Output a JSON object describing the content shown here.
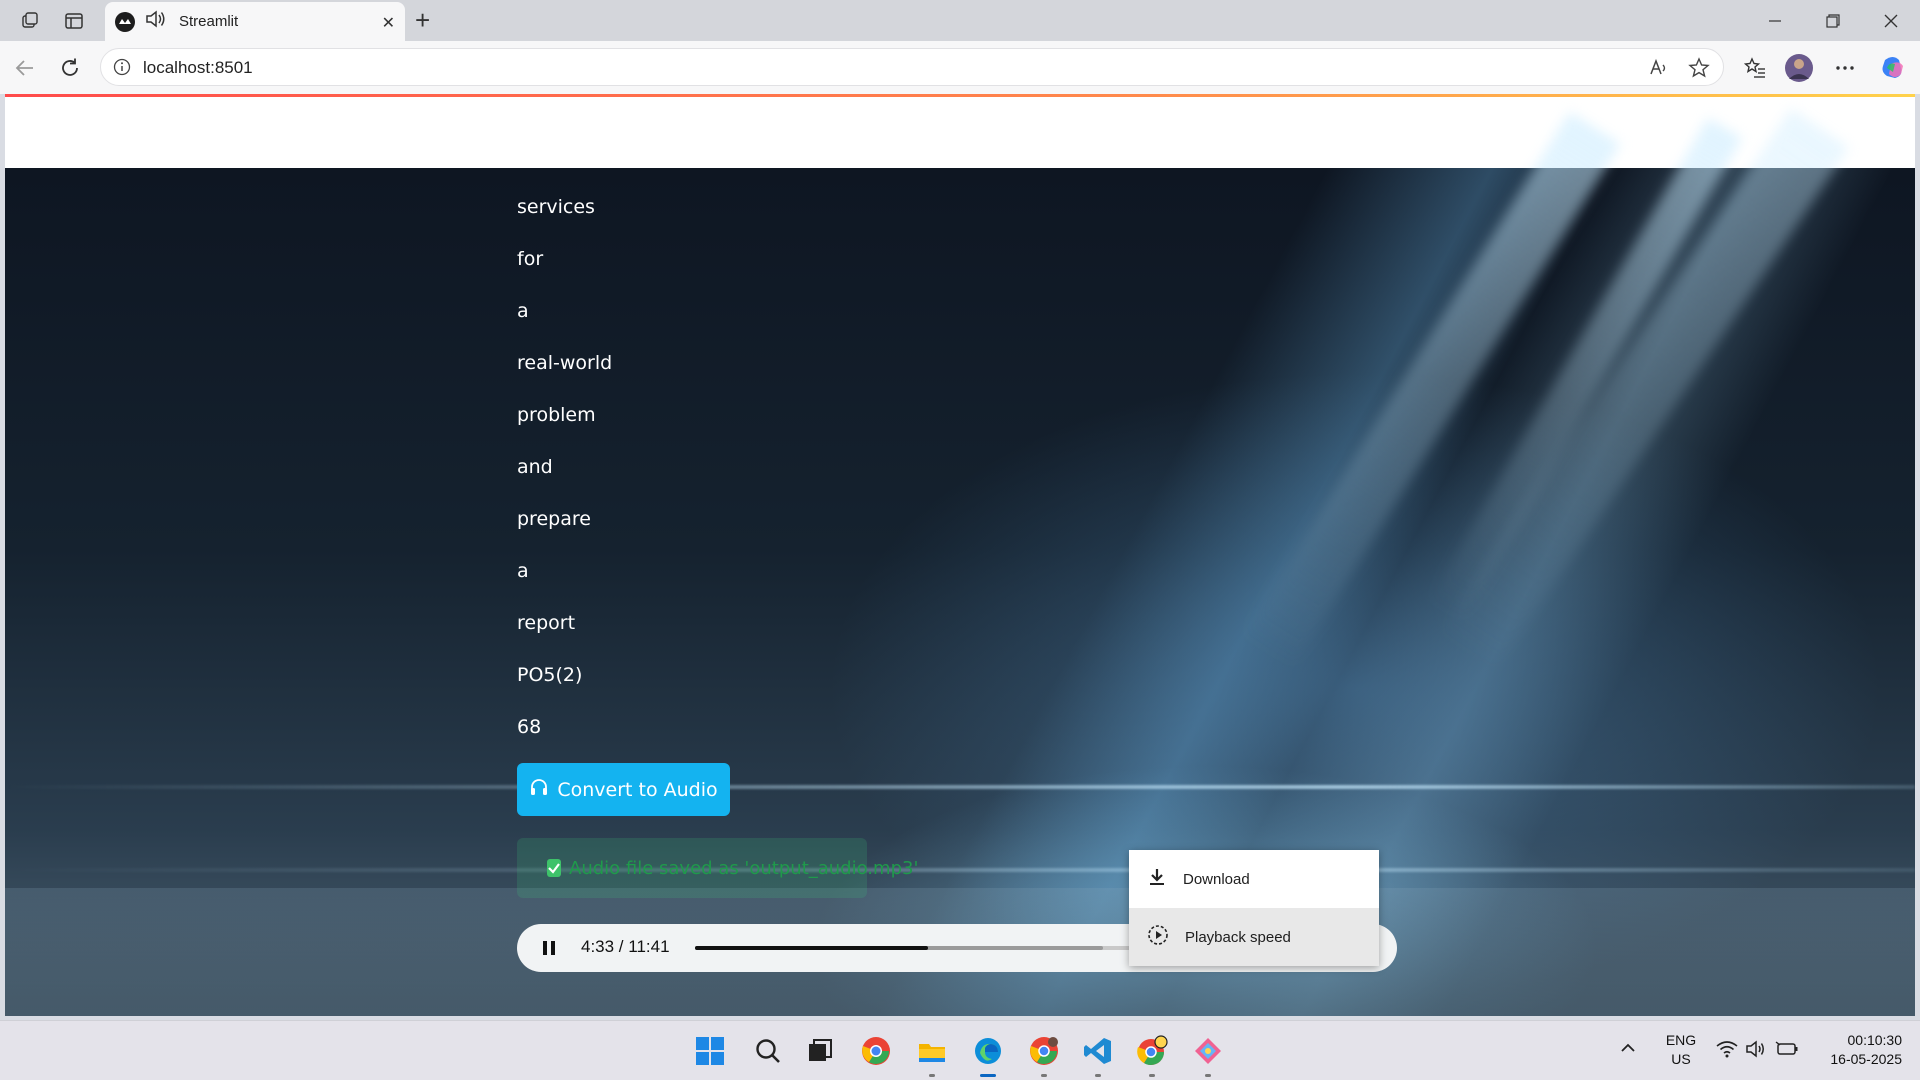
{
  "browser": {
    "tab_title": "Streamlit",
    "tab_close": "✕",
    "new_tab": "+",
    "url": "localhost:8501"
  },
  "content": {
    "words": [
      "services",
      "for",
      "a",
      "real-world",
      "problem",
      "and",
      "prepare",
      "a",
      "report",
      "PO5(2)",
      "68"
    ],
    "convert_button": "Convert to Audio",
    "success_message": "Audio file saved as 'output_audio.mp3'"
  },
  "player": {
    "time": "4:33 / 11:41",
    "progress": 0.389,
    "buffered": 0.68,
    "menu": {
      "download": "Download",
      "playback_speed": "Playback speed"
    }
  },
  "colors": {
    "accent_button": "#14b3f0",
    "success_text": "#1f9a4b",
    "edge_active": "#0a66c2"
  },
  "taskbar": {
    "language": "ENG",
    "region": "US",
    "time": "00:10:30",
    "date": "16-05-2025"
  }
}
